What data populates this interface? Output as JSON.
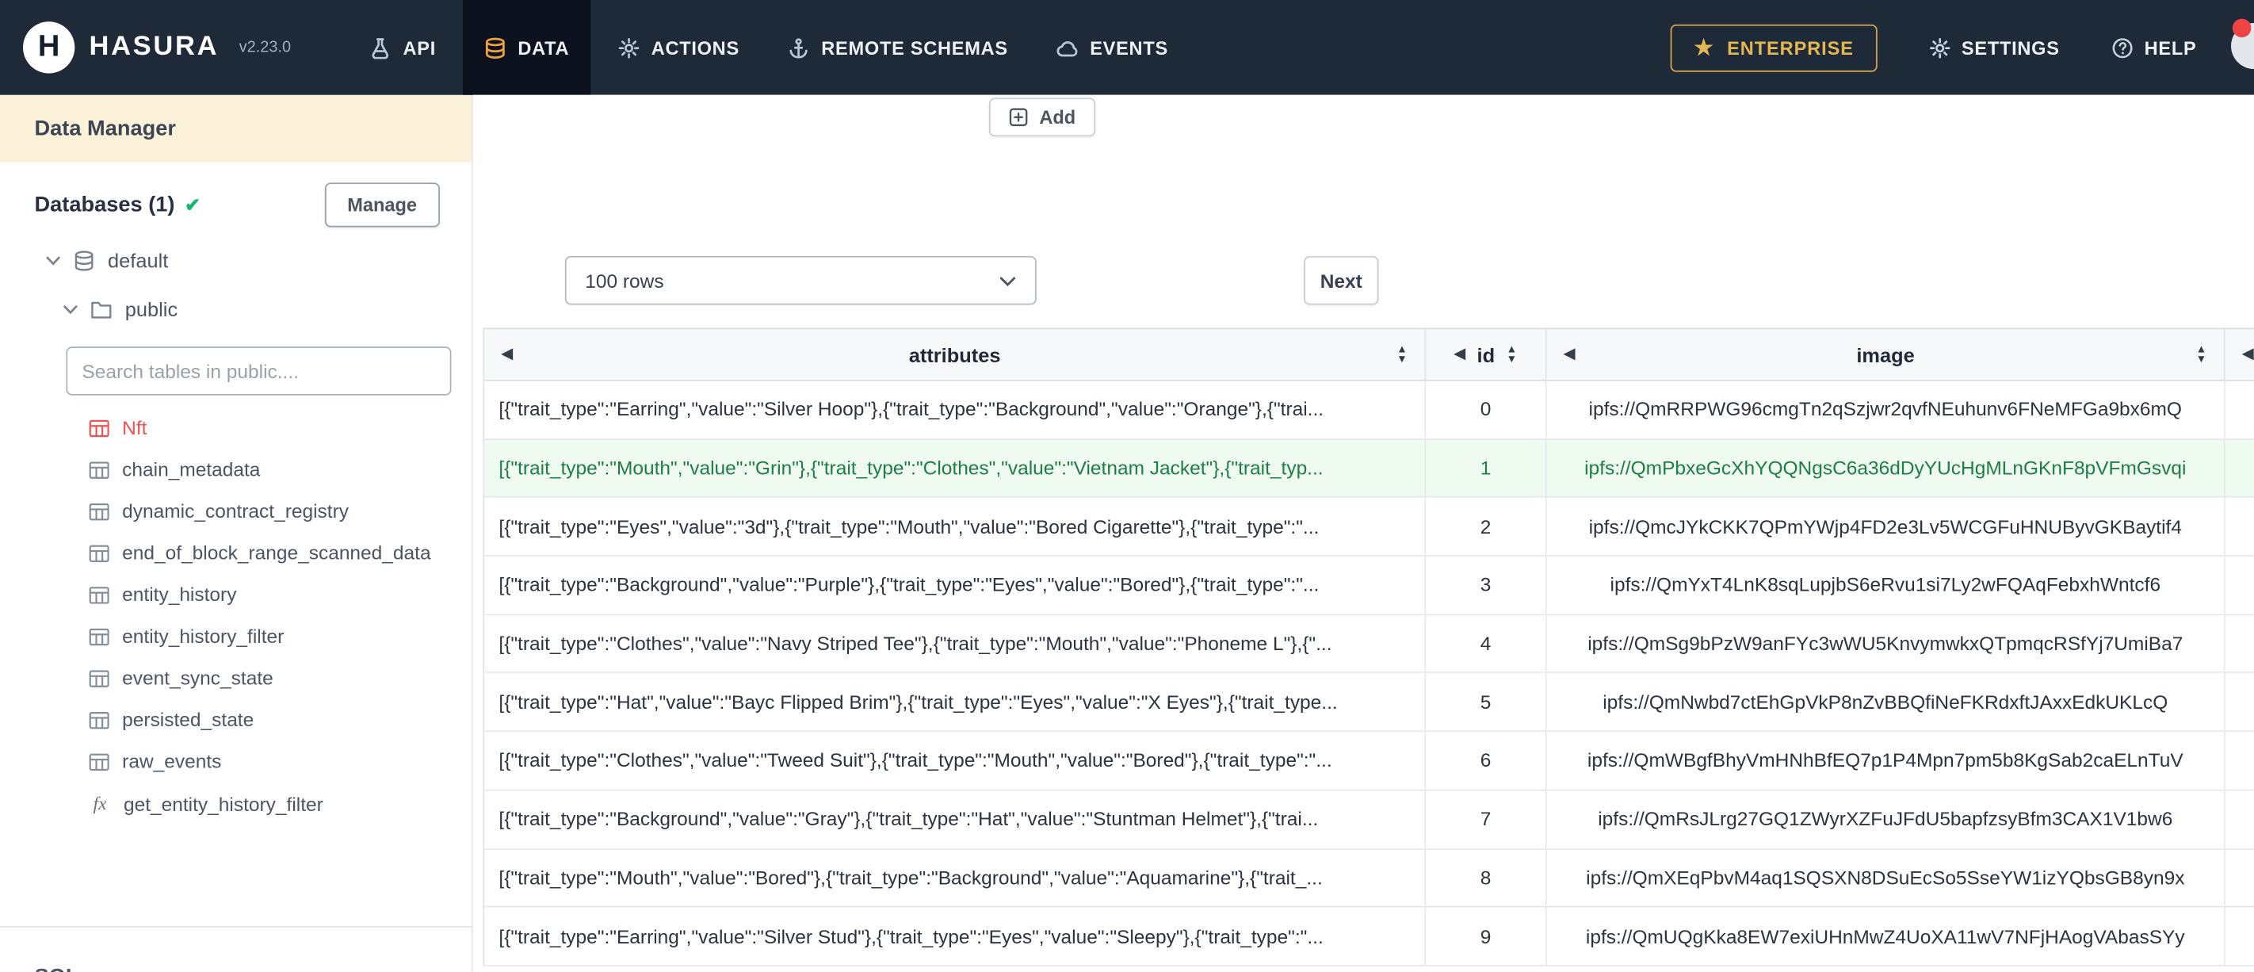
{
  "navbar": {
    "brand": "HASURA",
    "version": "v2.23.0",
    "items": [
      {
        "label": "API",
        "icon": "flask-icon",
        "active": false
      },
      {
        "label": "DATA",
        "icon": "database-icon",
        "active": true
      },
      {
        "label": "ACTIONS",
        "icon": "gears-icon",
        "active": false
      },
      {
        "label": "REMOTE SCHEMAS",
        "icon": "anchor-icon",
        "active": false
      },
      {
        "label": "EVENTS",
        "icon": "cloud-icon",
        "active": false
      }
    ],
    "enterprise": "ENTERPRISE",
    "settings": "SETTINGS",
    "help": "HELP"
  },
  "sidebar": {
    "title": "Data Manager",
    "databases_label": "Databases (1)",
    "manage_button": "Manage",
    "tree": {
      "database": "default",
      "schema": "public"
    },
    "search_placeholder": "Search tables in public....",
    "tables": [
      {
        "name": "Nft",
        "selected": true
      },
      {
        "name": "chain_metadata"
      },
      {
        "name": "dynamic_contract_registry"
      },
      {
        "name": "end_of_block_range_scanned_data"
      },
      {
        "name": "entity_history"
      },
      {
        "name": "entity_history_filter"
      },
      {
        "name": "event_sync_state"
      },
      {
        "name": "persisted_state"
      },
      {
        "name": "raw_events"
      }
    ],
    "functions": [
      {
        "name": "get_entity_history_filter"
      }
    ],
    "footer_label": "SQL"
  },
  "main": {
    "add_button": "Add",
    "rows_select": "100 rows",
    "next_button": "Next",
    "table": {
      "columns": [
        "attributes",
        "id",
        "image"
      ],
      "rows": [
        {
          "id": "0",
          "attributes": "[{\"trait_type\":\"Earring\",\"value\":\"Silver Hoop\"},{\"trait_type\":\"Background\",\"value\":\"Orange\"},{\"trai...",
          "image": "ipfs://QmRRPWG96cmgTn2qSzjwr2qvfNEuhunv6FNeMFGa9bx6mQ",
          "highlight": false
        },
        {
          "id": "1",
          "attributes": "[{\"trait_type\":\"Mouth\",\"value\":\"Grin\"},{\"trait_type\":\"Clothes\",\"value\":\"Vietnam Jacket\"},{\"trait_typ...",
          "image": "ipfs://QmPbxeGcXhYQQNgsC6a36dDyYUcHgMLnGKnF8pVFmGsvqi",
          "highlight": true
        },
        {
          "id": "2",
          "attributes": "[{\"trait_type\":\"Eyes\",\"value\":\"3d\"},{\"trait_type\":\"Mouth\",\"value\":\"Bored Cigarette\"},{\"trait_type\":\"...",
          "image": "ipfs://QmcJYkCKK7QPmYWjp4FD2e3Lv5WCGFuHNUByvGKBaytif4",
          "highlight": false
        },
        {
          "id": "3",
          "attributes": "[{\"trait_type\":\"Background\",\"value\":\"Purple\"},{\"trait_type\":\"Eyes\",\"value\":\"Bored\"},{\"trait_type\":\"...",
          "image": "ipfs://QmYxT4LnK8sqLupjbS6eRvu1si7Ly2wFQAqFebxhWntcf6",
          "highlight": false
        },
        {
          "id": "4",
          "attributes": "[{\"trait_type\":\"Clothes\",\"value\":\"Navy Striped Tee\"},{\"trait_type\":\"Mouth\",\"value\":\"Phoneme L\"},{\"...",
          "image": "ipfs://QmSg9bPzW9anFYc3wWU5KnvymwkxQTpmqcRSfYj7UmiBa7",
          "highlight": false
        },
        {
          "id": "5",
          "attributes": "[{\"trait_type\":\"Hat\",\"value\":\"Bayc Flipped Brim\"},{\"trait_type\":\"Eyes\",\"value\":\"X Eyes\"},{\"trait_type...",
          "image": "ipfs://QmNwbd7ctEhGpVkP8nZvBBQfiNeFKRdxftJAxxEdkUKLcQ",
          "highlight": false
        },
        {
          "id": "6",
          "attributes": "[{\"trait_type\":\"Clothes\",\"value\":\"Tweed Suit\"},{\"trait_type\":\"Mouth\",\"value\":\"Bored\"},{\"trait_type\":\"...",
          "image": "ipfs://QmWBgfBhyVmHNhBfEQ7p1P4Mpn7pm5b8KgSab2caELnTuV",
          "highlight": false
        },
        {
          "id": "7",
          "attributes": "[{\"trait_type\":\"Background\",\"value\":\"Gray\"},{\"trait_type\":\"Hat\",\"value\":\"Stuntman Helmet\"},{\"trai...",
          "image": "ipfs://QmRsJLrg27GQ1ZWyrXZFuJFdU5bapfzsyBfm3CAX1V1bw6",
          "highlight": false
        },
        {
          "id": "8",
          "attributes": "[{\"trait_type\":\"Mouth\",\"value\":\"Bored\"},{\"trait_type\":\"Background\",\"value\":\"Aquamarine\"},{\"trait_...",
          "image": "ipfs://QmXEqPbvM4aq1SQSXN8DSuEcSo5SseYW1izYQbsGB8yn9x",
          "highlight": false
        },
        {
          "id": "9",
          "attributes": "[{\"trait_type\":\"Earring\",\"value\":\"Silver Stud\"},{\"trait_type\":\"Eyes\",\"value\":\"Sleepy\"},{\"trait_type\":\"...",
          "image": "ipfs://QmUQgKka8EW7exiUHnMwZ4UoXA11wV7NFjHAogVAbasSYy",
          "highlight": false
        }
      ]
    }
  },
  "colors": {
    "navbar_bg": "#1e2a38",
    "active_tab_bg": "#0b121d",
    "enterprise_gold": "#e5b751",
    "selected_table_red": "#ef5350",
    "highlight_row_bg": "#effaf1",
    "highlight_row_text": "#1e7e46",
    "data_manager_header_bg": "#fbf2d9",
    "success_green": "#12b76a"
  }
}
